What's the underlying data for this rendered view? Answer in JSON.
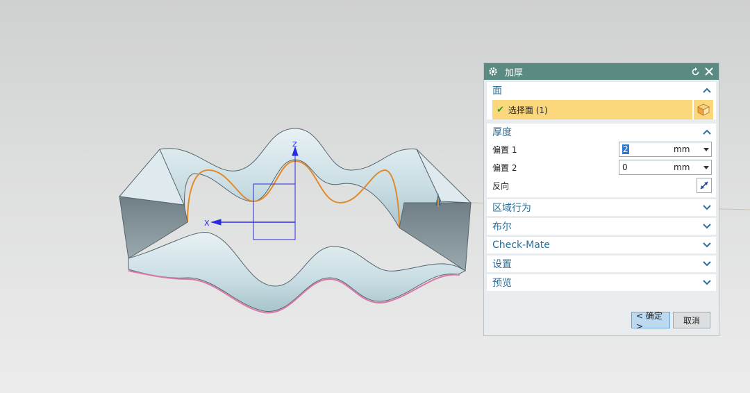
{
  "dialog": {
    "title": "加厚",
    "icons": {
      "settings": "gear-icon",
      "reset": "reset-icon",
      "close": "close-icon"
    },
    "face_section": {
      "label": "面",
      "select_label": "选择面 (1)"
    },
    "thickness_section": {
      "label": "厚度",
      "offset1_label": "偏置 1",
      "offset1_value": "2",
      "offset1_unit": "mm",
      "offset2_label": "偏置 2",
      "offset2_value": "0",
      "offset2_unit": "mm",
      "reverse_label": "反向"
    },
    "collapsed_sections": [
      "区域行为",
      "布尔",
      "Check-Mate",
      "设置",
      "预览"
    ],
    "ok_label": "< 确定 >",
    "cancel_label": "取消"
  },
  "viewport": {
    "axis_x": "X",
    "axis_z": "Z"
  },
  "colors": {
    "titlebar": "#5b8a83",
    "section_header_text": "#2a6f9a",
    "selection_highlight": "#fad77a",
    "ok_button": "#bcd9f0"
  }
}
